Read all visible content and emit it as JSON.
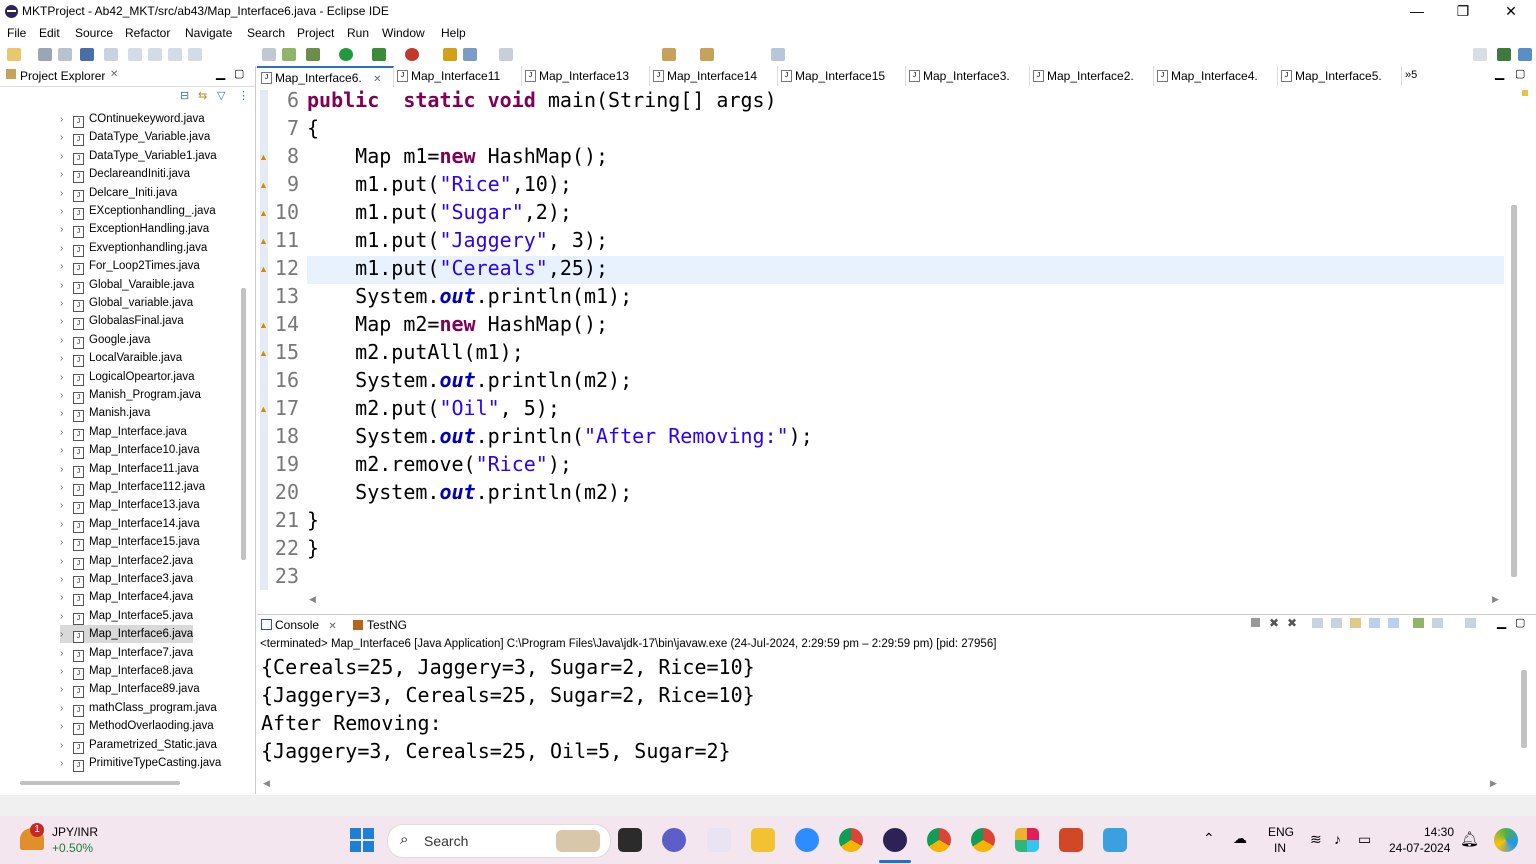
{
  "window": {
    "title": "MKTProject - Ab42_MKT/src/ab43/Map_Interface6.java - Eclipse IDE",
    "minimize": "—",
    "restore": "❐",
    "close": "✕"
  },
  "menu": [
    "File",
    "Edit",
    "Source",
    "Refactor",
    "Navigate",
    "Search",
    "Project",
    "Run",
    "Window",
    "Help"
  ],
  "explorer": {
    "title": "Project Explorer",
    "files": [
      "COntinuekeyword.java",
      "DataType_Variable.java",
      "DataType_Variable1.java",
      "DeclareandIniti.java",
      "Delcare_Initi.java",
      "EXceptionhandling_.java",
      "ExceptionHandling.java",
      "Exveptionhandling.java",
      "For_Loop2Times.java",
      "Global_Varaible.java",
      "Global_variable.java",
      "GlobalasFinal.java",
      "Google.java",
      "LocalVaraible.java",
      "LogicalOpeartor.java",
      "Manish_Program.java",
      "Manish.java",
      "Map_Interface.java",
      "Map_Interface10.java",
      "Map_Interface11.java",
      "Map_Interface112.java",
      "Map_Interface13.java",
      "Map_Interface14.java",
      "Map_Interface15.java",
      "Map_Interface2.java",
      "Map_Interface3.java",
      "Map_Interface4.java",
      "Map_Interface5.java",
      "Map_Interface6.java",
      "Map_Interface7.java",
      "Map_Interface8.java",
      "Map_Interface89.java",
      "mathClass_program.java",
      "MethodOverlaoding.java",
      "Parametrized_Static.java",
      "PrimitiveTypeCasting.java"
    ],
    "selected": "Map_Interface6.java"
  },
  "tabs": [
    "Map_Interface6.",
    "Map_Interface11",
    "Map_Interface13",
    "Map_Interface14",
    "Map_Interface15",
    "Map_Interface3.",
    "Map_Interface2.",
    "Map_Interface4.",
    "Map_Interface5."
  ],
  "tabs_overflow": "»5",
  "editor": {
    "lines": [
      {
        "n": "6",
        "code": [
          [
            "kw",
            "public"
          ],
          [
            "",
            "  "
          ],
          [
            "kw",
            "static"
          ],
          [
            "",
            " "
          ],
          [
            "kw",
            "void"
          ],
          [
            "",
            " main(String[] args)"
          ]
        ]
      },
      {
        "n": "7",
        "code": [
          [
            "",
            "{"
          ]
        ]
      },
      {
        "n": "8",
        "code": [
          [
            "",
            "    Map m1="
          ],
          [
            "kw",
            "new"
          ],
          [
            "",
            " HashMap();"
          ]
        ]
      },
      {
        "n": "9",
        "code": [
          [
            "",
            "    m1.put("
          ],
          [
            "str",
            "\"Rice\""
          ],
          [
            "",
            ",10);"
          ]
        ]
      },
      {
        "n": "10",
        "code": [
          [
            "",
            "    m1.put("
          ],
          [
            "str",
            "\"Sugar\""
          ],
          [
            "",
            ",2);"
          ]
        ]
      },
      {
        "n": "11",
        "code": [
          [
            "",
            "    m1.put("
          ],
          [
            "str",
            "\"Jaggery\""
          ],
          [
            "",
            ", 3);"
          ]
        ]
      },
      {
        "n": "12",
        "code": [
          [
            "",
            "    m1.put("
          ],
          [
            "str",
            "\"Cereals\""
          ],
          [
            "",
            ",25);"
          ]
        ]
      },
      {
        "n": "13",
        "code": [
          [
            "",
            "    System."
          ],
          [
            "fld",
            "out"
          ],
          [
            "",
            ".println(m1);"
          ]
        ]
      },
      {
        "n": "14",
        "code": [
          [
            "",
            "    Map m2="
          ],
          [
            "kw",
            "new"
          ],
          [
            "",
            " HashMap();"
          ]
        ]
      },
      {
        "n": "15",
        "code": [
          [
            "",
            "    m2.putAll(m1);"
          ]
        ]
      },
      {
        "n": "16",
        "code": [
          [
            "",
            "    System."
          ],
          [
            "fld",
            "out"
          ],
          [
            "",
            ".println(m2);"
          ]
        ]
      },
      {
        "n": "17",
        "code": [
          [
            "",
            "    m2.put("
          ],
          [
            "str",
            "\"Oil\""
          ],
          [
            "",
            ", 5);"
          ]
        ]
      },
      {
        "n": "18",
        "code": [
          [
            "",
            "    System."
          ],
          [
            "fld",
            "out"
          ],
          [
            "",
            ".println("
          ],
          [
            "str",
            "\"After Removing:\""
          ],
          [
            "",
            ");"
          ]
        ]
      },
      {
        "n": "19",
        "code": [
          [
            "",
            "    m2.remove("
          ],
          [
            "str",
            "\"Rice\""
          ],
          [
            "",
            ");"
          ]
        ]
      },
      {
        "n": "20",
        "code": [
          [
            "",
            "    System."
          ],
          [
            "fld",
            "out"
          ],
          [
            "",
            ".println(m2);"
          ]
        ]
      },
      {
        "n": "21",
        "code": [
          [
            "",
            "}"
          ]
        ]
      },
      {
        "n": "22",
        "code": [
          [
            "",
            "}"
          ]
        ]
      },
      {
        "n": "23",
        "code": [
          [
            "",
            ""
          ]
        ]
      }
    ]
  },
  "console": {
    "tab_console": "Console",
    "tab_testng": "TestNG",
    "header": "<terminated> Map_Interface6 [Java Application] C:\\Program Files\\Java\\jdk-17\\bin\\javaw.exe  (24-Jul-2024, 2:29:59 pm – 2:29:59 pm) [pid: 27956]",
    "output": [
      "{Cereals=25, Jaggery=3, Sugar=2, Rice=10}",
      "{Jaggery=3, Cereals=25, Sugar=2, Rice=10}",
      "After Removing:",
      "{Jaggery=3, Cereals=25, Oil=5, Sugar=2}"
    ]
  },
  "taskbar": {
    "stock_name": "JPY/INR",
    "stock_change": "+0.50%",
    "stock_badge": "1",
    "search_placeholder": "Search",
    "lang_top": "ENG",
    "lang_bottom": "IN",
    "time": "14:30",
    "date": "24-07-2024"
  },
  "colors": {
    "keyword": "#7f0055",
    "string": "#2a00ff",
    "field": "#0000c0",
    "line_highlight": "#e8f2fe",
    "taskbar_bg": "#f3e6ee"
  }
}
